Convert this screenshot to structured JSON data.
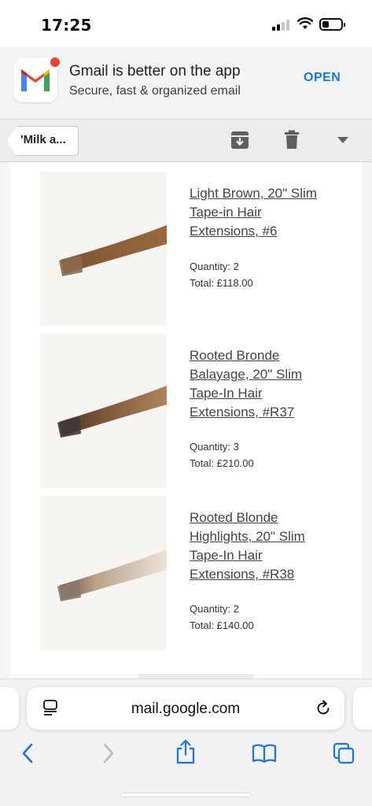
{
  "status_bar": {
    "time": "17:25",
    "battery_level": 0.35
  },
  "promo": {
    "title": "Gmail is better on the app",
    "subtitle": "Secure, fast & organized email",
    "open_label": "OPEN"
  },
  "toolbar": {
    "back_label": "'Milk a..."
  },
  "products": [
    {
      "name": "Light Brown, 20\" Slim Tape-in Hair Extensions, #6",
      "quantity": "Quantity: 2",
      "total": "Total: £118.00",
      "hair_root": "#7a5333",
      "hair_tip": "#9a6a3f"
    },
    {
      "name": "Rooted Bronde Balayage, 20\" Slim Tape-In Hair Extensions, #R37",
      "quantity": "Quantity: 3",
      "total": "Total: £210.00",
      "hair_root": "#4a3525",
      "hair_tip": "#b0855a"
    },
    {
      "name": "Rooted Blonde Highlights, 20\" Slim Tape-In Hair Extensions, #R38",
      "quantity": "Quantity: 2",
      "total": "Total: £140.00",
      "hair_root": "#6b5240",
      "hair_tip": "#ece3d6"
    }
  ],
  "browser": {
    "url": "mail.google.com"
  },
  "colors": {
    "accent": "#1a73e8",
    "gmail_red": "#ea4335"
  }
}
